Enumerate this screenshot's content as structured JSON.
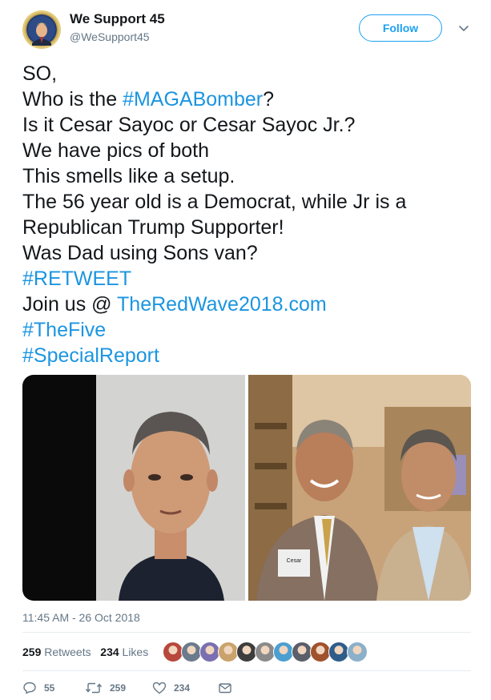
{
  "user": {
    "display_name": "We Support 45",
    "handle": "@WeSupport45",
    "avatar_icon": "presidential-portrait-avatar"
  },
  "follow_label": "Follow",
  "tweet_lines": [
    [
      {
        "t": "SO,",
        "link": false
      }
    ],
    [
      {
        "t": "Who is the ",
        "link": false
      },
      {
        "t": "#MAGABomber",
        "link": true
      },
      {
        "t": "?",
        "link": false
      }
    ],
    [
      {
        "t": "Is it Cesar Sayoc or Cesar Sayoc Jr.?",
        "link": false
      }
    ],
    [
      {
        "t": "We have pics of both",
        "link": false
      }
    ],
    [
      {
        "t": "This smells like a setup.",
        "link": false
      }
    ],
    [
      {
        "t": "The 56 year old is a Democrat, while Jr is a",
        "link": false
      }
    ],
    [
      {
        "t": "Republican Trump Supporter!",
        "link": false
      }
    ],
    [
      {
        "t": "Was Dad using Sons van?",
        "link": false
      }
    ],
    [
      {
        "t": "#RETWEET",
        "link": true
      }
    ],
    [
      {
        "t": "Join us @ ",
        "link": false
      },
      {
        "t": "TheRedWave2018.com",
        "link": true
      }
    ],
    [
      {
        "t": "#TheFive",
        "link": true
      }
    ],
    [
      {
        "t": "#SpecialReport",
        "link": true
      }
    ]
  ],
  "media": {
    "left_photo": "mugshot-photo",
    "right_photo": "two-men-photo",
    "name_tag_text": "Cesar"
  },
  "timestamp": "11:45 AM - 26 Oct 2018",
  "stats": {
    "retweets_count": "259",
    "retweets_label": "Retweets",
    "likes_count": "234",
    "likes_label": "Likes"
  },
  "actions": {
    "reply_count": "55",
    "retweet_count": "259",
    "like_count": "234"
  },
  "colors": {
    "accent": "#1da1f2",
    "link": "#1b95e0",
    "muted": "#657786"
  },
  "liker_avatars": [
    "#b8473c",
    "#6b7a8c",
    "#7a6fb0",
    "#c9a36b",
    "#3d3d3d",
    "#8a8a8a",
    "#4b9fd1",
    "#5a5f6a",
    "#a0522d",
    "#2f5d8a",
    "#8bb0c9"
  ]
}
